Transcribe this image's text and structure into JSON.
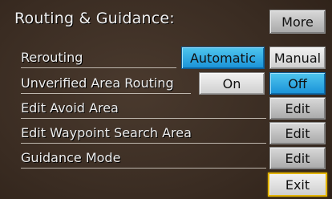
{
  "title": "Routing & Guidance:",
  "more_label": "More",
  "exit_label": "Exit",
  "rows": [
    {
      "label": "Rerouting",
      "options": [
        "Automatic",
        "Manual"
      ],
      "selected": "Automatic"
    },
    {
      "label": "Unverified Area Routing",
      "options": [
        "On",
        "Off"
      ],
      "selected": "Off"
    },
    {
      "label": "Edit Avoid Area",
      "action": "Edit"
    },
    {
      "label": "Edit Waypoint Search Area",
      "action": "Edit"
    },
    {
      "label": "Guidance Mode",
      "action": "Edit"
    }
  ],
  "colors": {
    "selected": "#2aa6e4",
    "exit_highlight": "#e2b400"
  }
}
